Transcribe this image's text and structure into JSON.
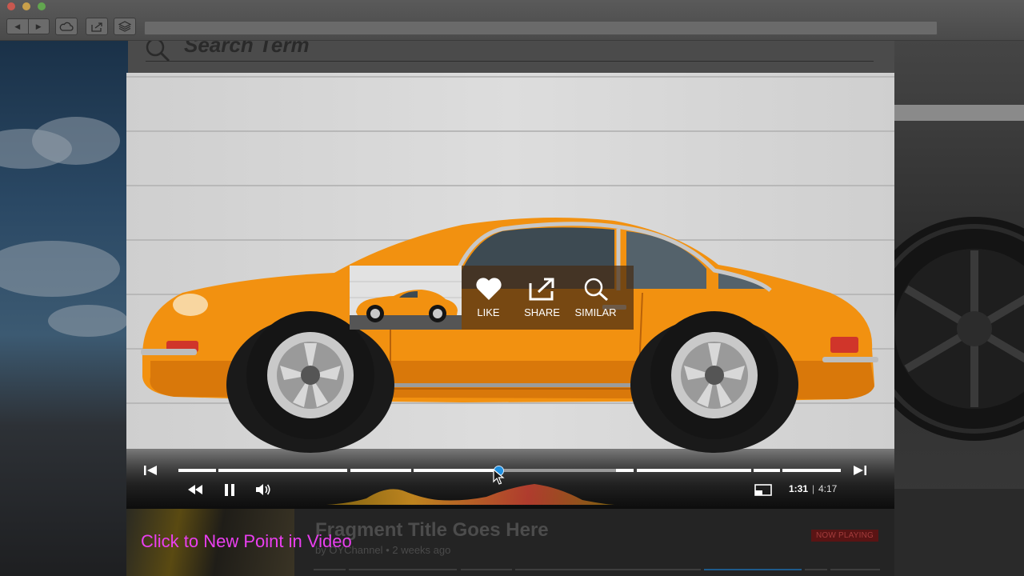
{
  "search": {
    "placeholder": "Search Term"
  },
  "popup": {
    "like_label": "LIKE",
    "share_label": "SHARE",
    "similar_label": "SIMILAR"
  },
  "player": {
    "current_time": "1:31",
    "time_separator": "|",
    "duration": "4:17",
    "progress": 0.354
  },
  "fragment": {
    "title": "Fragment Title Goes Here",
    "channel": "by OYChannel",
    "age": "2 weeks ago",
    "badge": "NOW PLAYING"
  },
  "annotation": "Click to New Point in Video",
  "colors": {
    "accent": "#1e8fe0",
    "annotation": "#ea3ff0",
    "car": "#f29110",
    "badge": "#5a1414"
  }
}
